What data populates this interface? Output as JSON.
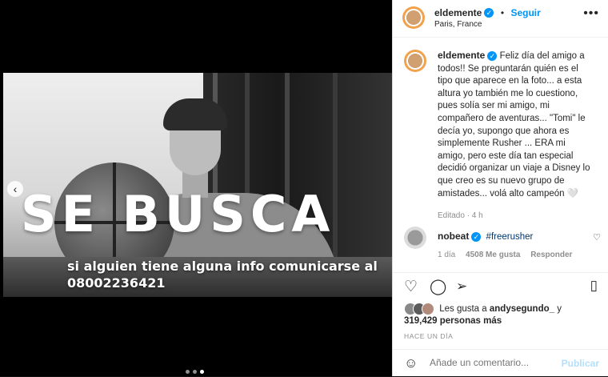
{
  "post": {
    "headline": "SE BUSCA",
    "subline": "si alguien tiene alguna info comunicarse al",
    "phone": "08002236421"
  },
  "header": {
    "username": "eldemente",
    "dot": "•",
    "follow": "Seguir",
    "location": "Paris, France",
    "more": "•••"
  },
  "caption": {
    "username": "eldemente",
    "text": "Feliz día del amigo a todos!! Se preguntarán quién es el tipo que aparece en la foto... a esta altura yo también me lo cuestiono, pues solía ser mi amigo, mi compañero de aventuras... \"Tomi\" le decía yo, supongo que ahora es simplemente Rusher ... ERA mi amigo, pero este día tan especial decidió organizar un viaje a Disney lo que creo es su nuevo grupo de amistades... volá alto campeón 🤍",
    "edited": "Editado · 4 h"
  },
  "comment": {
    "username": "nobeat",
    "text": "#freerusher",
    "age": "1 día",
    "likes": "4508 Me gusta",
    "reply": "Responder"
  },
  "likes": {
    "prefix": "Les gusta a",
    "user": "andysegundo_",
    "connector": "y",
    "count": "319,429 personas más"
  },
  "timestamp": "HACE UN DÍA",
  "add_comment": {
    "placeholder": "Añade un comentario...",
    "publish": "Publicar"
  },
  "carousel": {
    "total": 3,
    "active": 3
  },
  "colors": {
    "accent": "#0095f6",
    "text": "#262626",
    "muted": "#8e8e8e"
  }
}
